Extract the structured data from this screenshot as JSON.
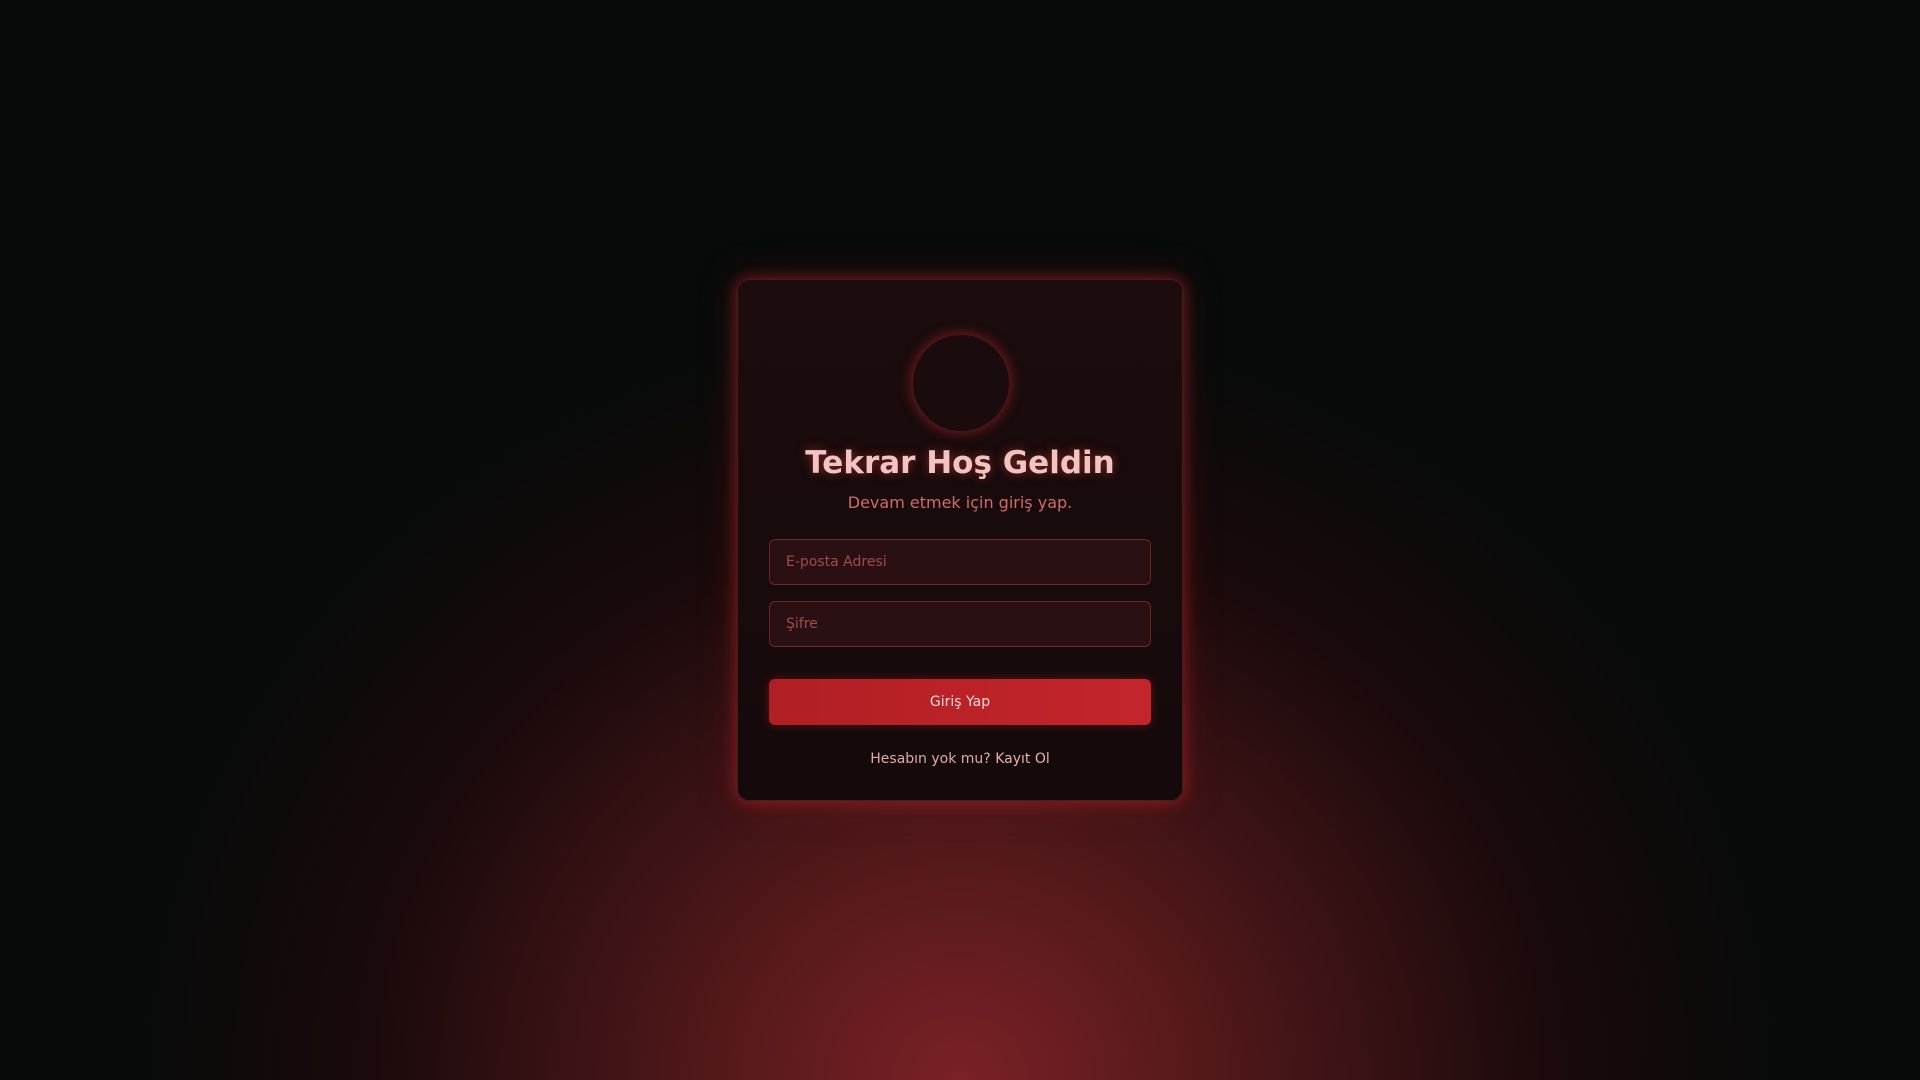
{
  "login": {
    "title": "Tekrar Hoş Geldin",
    "subtitle": "Devam etmek için giriş yap.",
    "email_placeholder": "E-posta Adresi",
    "password_placeholder": "Şifre",
    "submit_label": "Giriş Yap",
    "signup_prompt": "Hesabın yok mu?",
    "signup_link": "Kayıt Ol"
  },
  "colors": {
    "accent": "#c4252b",
    "title": "#f0c4c2",
    "background": "#080a0a"
  }
}
